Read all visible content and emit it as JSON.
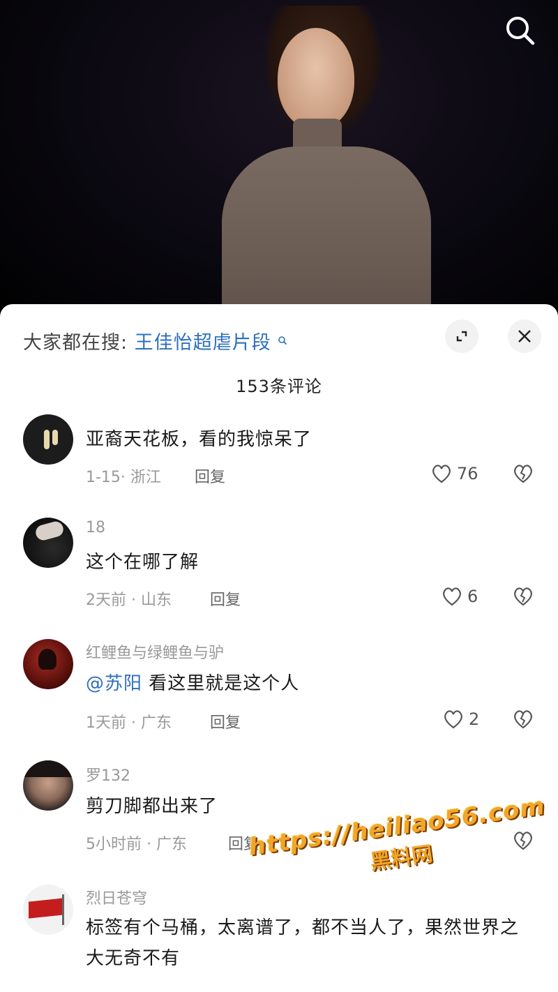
{
  "search_bar": {
    "prefix": "大家都在搜:",
    "keyword": "王佳怡超虐片段"
  },
  "comment_count": "153条评论",
  "comments": [
    {
      "author": "",
      "text": "亚裔天花板，看的我惊呆了",
      "meta": "1-15· 浙江",
      "reply": "回复",
      "likes": "76"
    },
    {
      "author": "18",
      "text": "这个在哪了解",
      "meta": "2天前 · 山东",
      "reply": "回复",
      "likes": "6"
    },
    {
      "author": "红鲤鱼与绿鲤鱼与驴",
      "mention": "@苏阳",
      "text": "看这里就是这个人",
      "meta": "1天前 · 广东",
      "reply": "回复",
      "likes": "2"
    },
    {
      "author": "罗132",
      "text": "剪刀脚都出来了",
      "meta": "5小时前 · 广东",
      "reply": "回复",
      "likes": ""
    },
    {
      "author": "烈日苍穹",
      "text": "标签有个马桶，太离谱了，都不当人了，果然世界之大无奇不有",
      "meta": "",
      "reply": "",
      "likes": ""
    }
  ],
  "watermark": {
    "url": "https://heiliao56.com",
    "name": "黑料网"
  },
  "colors": {
    "accent": "#2d6fbf",
    "sheet_bg": "#ffffff",
    "video_bg": "#000000"
  }
}
